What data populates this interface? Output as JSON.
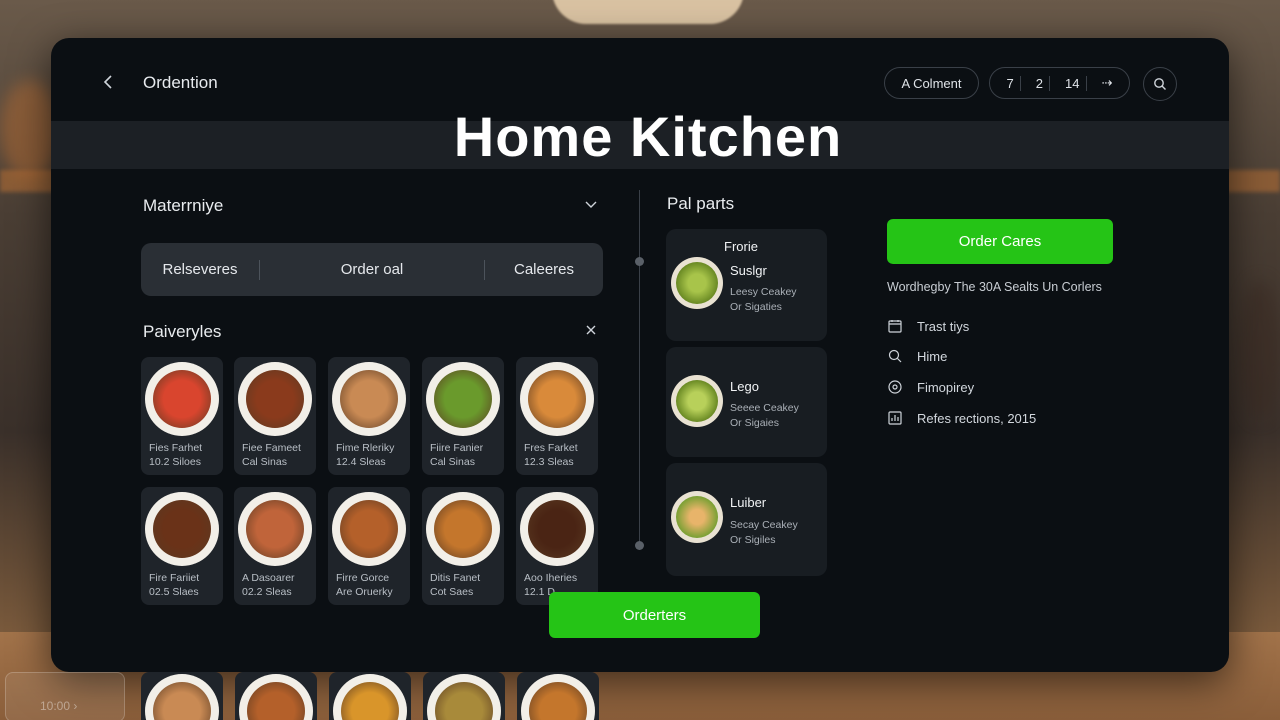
{
  "header": {
    "title": "Ordention",
    "account_label": "A Colment",
    "nums": [
      "7",
      "2",
      "14",
      "⇢"
    ],
    "hero": "Home Kitchen"
  },
  "left": {
    "section1": "Materrniye",
    "segments": [
      "Relseveres",
      "Order oal",
      "Caleeres"
    ],
    "section2": "Paiveryles",
    "tiles": [
      {
        "l1": "Fies Farhet",
        "l2": "10.2 Siloes",
        "icon": "pasta",
        "color": "#d9452e"
      },
      {
        "l1": "Fiee Fameet",
        "l2": "Cal Sinas",
        "icon": "chili",
        "color": "#8a3a1c"
      },
      {
        "l1": "Fime Rleriky",
        "l2": "12.4 Sleas",
        "icon": "fish",
        "color": "#c98a54"
      },
      {
        "l1": "Fiire Fanier",
        "l2": "Cal Sinas",
        "icon": "salad",
        "color": "#6a9a2c"
      },
      {
        "l1": "Fres Farket",
        "l2": "12.3 Sleas",
        "icon": "fried",
        "color": "#d98a3a"
      },
      {
        "l1": "Fire Fariiet",
        "l2": "02.5 Slaes",
        "icon": "steak",
        "color": "#6a3218"
      },
      {
        "l1": "A Dasoarer",
        "l2": "02.2 Sleas",
        "icon": "noodles",
        "color": "#c0643a"
      },
      {
        "l1": "Firre Gorce",
        "l2": "Are Oruerky",
        "icon": "roast",
        "color": "#b4602a"
      },
      {
        "l1": "Ditis Fanet",
        "l2": "Cot Saes",
        "icon": "box",
        "color": "#c4762c"
      },
      {
        "l1": "Aoo Iheries",
        "l2": "12.1 D...",
        "icon": "mince",
        "color": "#4a2414"
      }
    ]
  },
  "middle": {
    "title": "Pal parts",
    "cards": [
      {
        "title": "Frorie",
        "name": "Suslgr",
        "s1": "Leesy Ceakey",
        "s2": "Or Sigaties",
        "color": "#7aa034"
      },
      {
        "name": "Lego",
        "s1": "Seeee Ceakey",
        "s2": "Or Sigaies",
        "color": "#86a83a"
      },
      {
        "name": "Luiber",
        "s1": "Secay Ceakey",
        "s2": "Or Sigiles",
        "color": "#b88a4a"
      }
    ]
  },
  "right": {
    "order_btn": "Order Cares",
    "subtitle": "Wordhegby The 30A Sealts Un Corlers",
    "meta": [
      {
        "icon": "calendar-icon",
        "text": "Trast tiys"
      },
      {
        "icon": "search-icon",
        "text": "Hime"
      },
      {
        "icon": "info-icon",
        "text": "Fimopirey"
      },
      {
        "icon": "chart-icon",
        "text": "Refes rections, 2015"
      }
    ]
  },
  "bottom": {
    "order_btn": "Orderters",
    "corner_text": "10:00 ›",
    "tile_colors": [
      "#c98a54",
      "#b4602a",
      "#d9952a",
      "#a88a3a",
      "#c4762c"
    ]
  }
}
